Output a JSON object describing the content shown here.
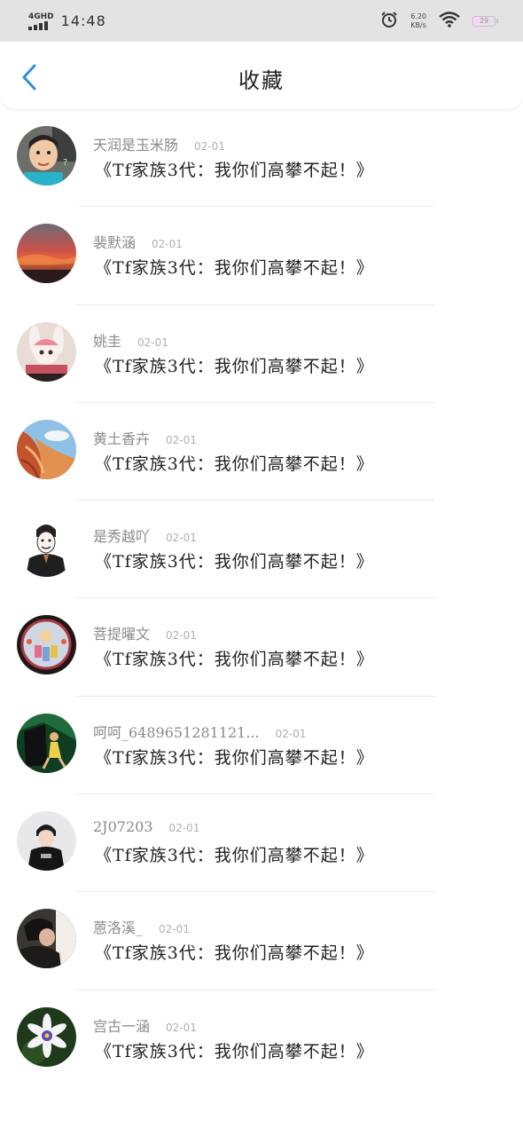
{
  "status_bar": {
    "network": "4GHD",
    "time": "14:48",
    "speed_value": "6.20",
    "speed_unit": "KB/s",
    "battery": "29",
    "battery_level": 0.29
  },
  "header": {
    "title": "收藏",
    "back_icon": "chevron-left-icon"
  },
  "colors": {
    "accent": "#2d8ee0",
    "status_bar_bg": "#e3e3e3"
  },
  "items": [
    {
      "username": "天润是玉米肠",
      "date": "02-01",
      "title": "《Tf家族3代：我你们高攀不起！》"
    },
    {
      "username": "裴默涵",
      "date": "02-01",
      "title": "《Tf家族3代：我你们高攀不起！》"
    },
    {
      "username": "姚圭",
      "date": "02-01",
      "title": "《Tf家族3代：我你们高攀不起！》"
    },
    {
      "username": "黄土香卉",
      "date": "02-01",
      "title": "《Tf家族3代：我你们高攀不起！》"
    },
    {
      "username": "是秀越吖",
      "date": "02-01",
      "title": "《Tf家族3代：我你们高攀不起！》"
    },
    {
      "username": "菩提曜文",
      "date": "02-01",
      "title": "《Tf家族3代：我你们高攀不起！》"
    },
    {
      "username": "呵呵_6489651281121...",
      "date": "02-01",
      "title": "《Tf家族3代：我你们高攀不起！》"
    },
    {
      "username": "2J07203",
      "date": "02-01",
      "title": "《Tf家族3代：我你们高攀不起！》"
    },
    {
      "username": "蒽洛溪_",
      "date": "02-01",
      "title": "《Tf家族3代：我你们高攀不起！》"
    },
    {
      "username": "宫古一涵",
      "date": "02-01",
      "title": "《Tf家族3代：我你们高攀不起！》"
    }
  ]
}
